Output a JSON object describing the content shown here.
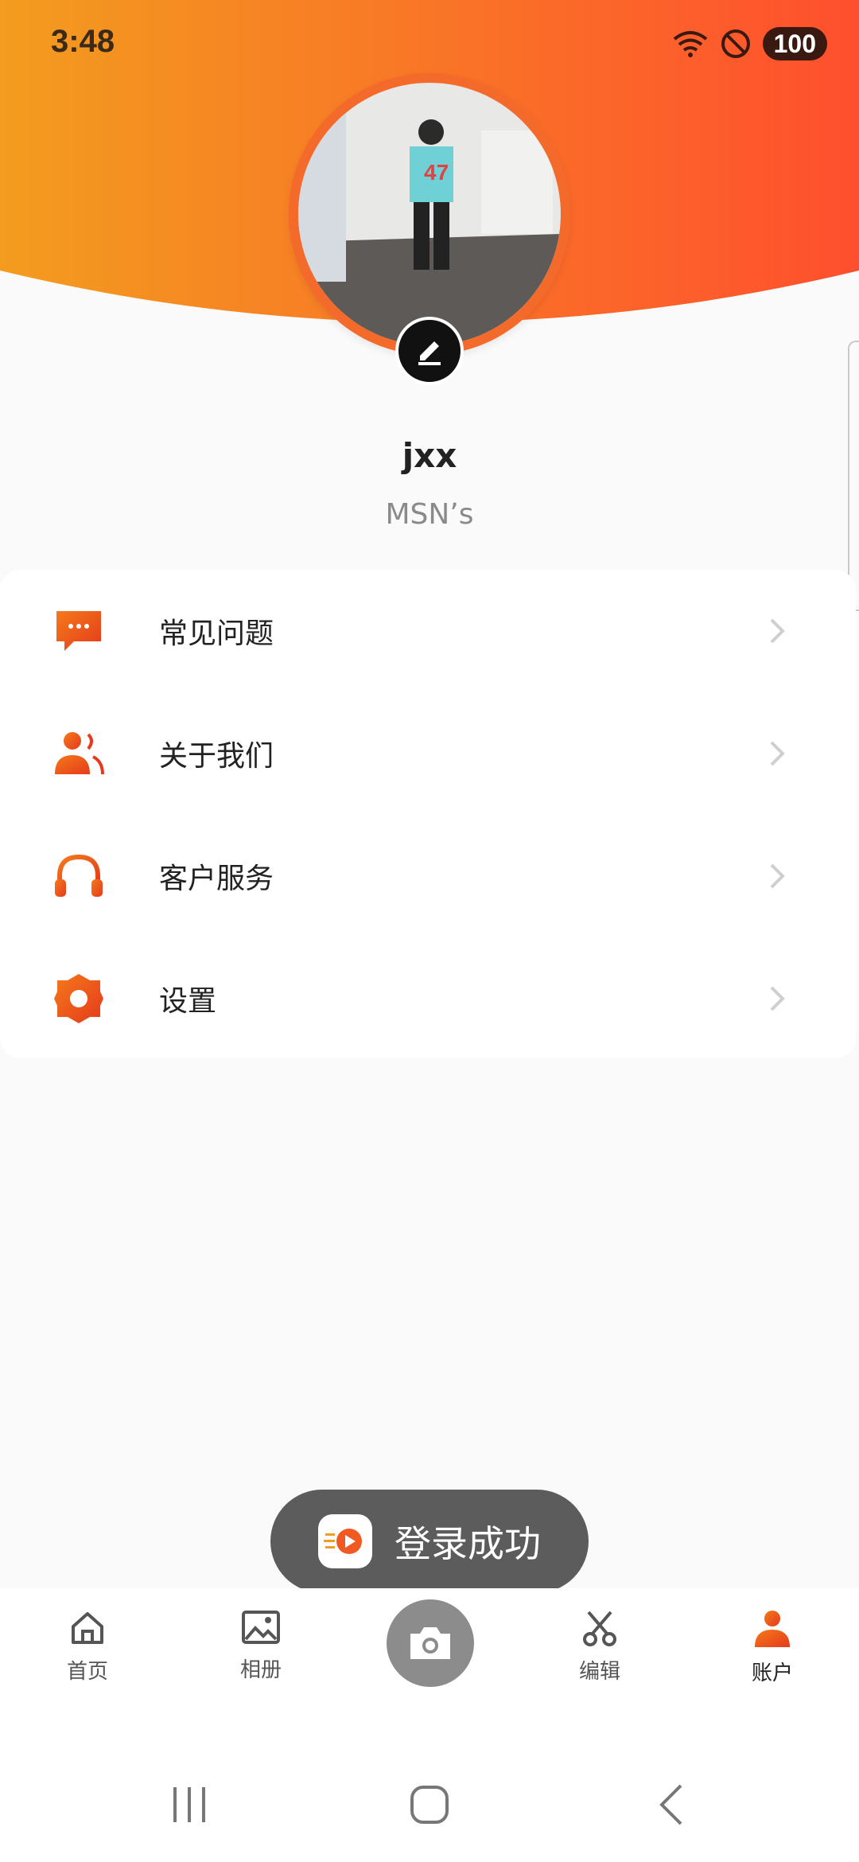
{
  "status_bar": {
    "time": "3:48",
    "battery": "100"
  },
  "profile": {
    "username": "jxx",
    "subtitle": "MSN’s"
  },
  "menu": [
    {
      "label": "常见问题",
      "icon": "chat-bubble-icon"
    },
    {
      "label": "关于我们",
      "icon": "people-icon"
    },
    {
      "label": "客户服务",
      "icon": "headphones-icon"
    },
    {
      "label": "设置",
      "icon": "gear-icon"
    }
  ],
  "toast": {
    "text": "登录成功"
  },
  "bottom_nav": [
    {
      "label": "首页",
      "icon": "home-icon"
    },
    {
      "label": "相册",
      "icon": "gallery-icon"
    },
    {
      "label": "",
      "icon": "camera-icon"
    },
    {
      "label": "编辑",
      "icon": "scissors-icon"
    },
    {
      "label": "账户",
      "icon": "account-icon",
      "active": true
    }
  ],
  "colors": {
    "accent_start": "#f39c1f",
    "accent_end": "#ff4f2e",
    "toast_bg": "#5c5c5c"
  }
}
